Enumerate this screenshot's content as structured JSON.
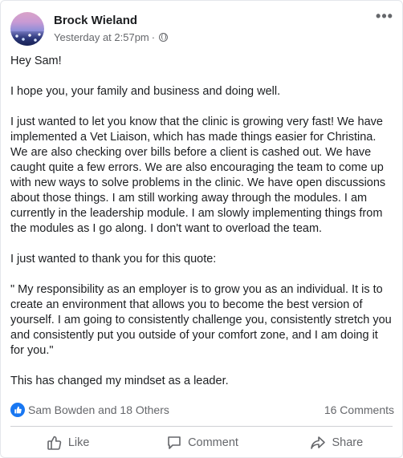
{
  "post": {
    "author": "Brock Wieland",
    "timestamp": "Yesterday at 2:57pm",
    "separator": "·",
    "more_icon": "ellipsis-icon",
    "paragraphs": [
      "Hey Sam!",
      "I hope you, your family and business and doing well.",
      "I just wanted to let you know that the clinic is growing very fast! We have implemented a Vet Liaison, which has made things easier for Christina. We are also checking over bills before a client is cashed out. We have caught quite a few errors. We are also encouraging the team to come up with new ways to solve problems in the clinic. We have open discussions about those things. I am still working away through the modules. I am currently in the leadership module. I am slowly implementing things from the modules as I go along. I don't want to overload the team.",
      "I just wanted to thank you for this quote:",
      "\" My responsibility as an employer is to grow you as an individual. It is to create an environment that allows you to become the best version of yourself. I am going to consistently challenge you, consistently stretch you and consistently put you outside of your comfort zone, and I am doing it for you.\"",
      "This has changed my mindset as a leader."
    ]
  },
  "stats": {
    "reactions_text": "Sam Bowden and 18 Others",
    "comments_text": "16 Comments"
  },
  "actions": {
    "like": "Like",
    "comment": "Comment",
    "share": "Share"
  },
  "colors": {
    "accent": "#1877f2",
    "secondary_text": "#65676b"
  }
}
